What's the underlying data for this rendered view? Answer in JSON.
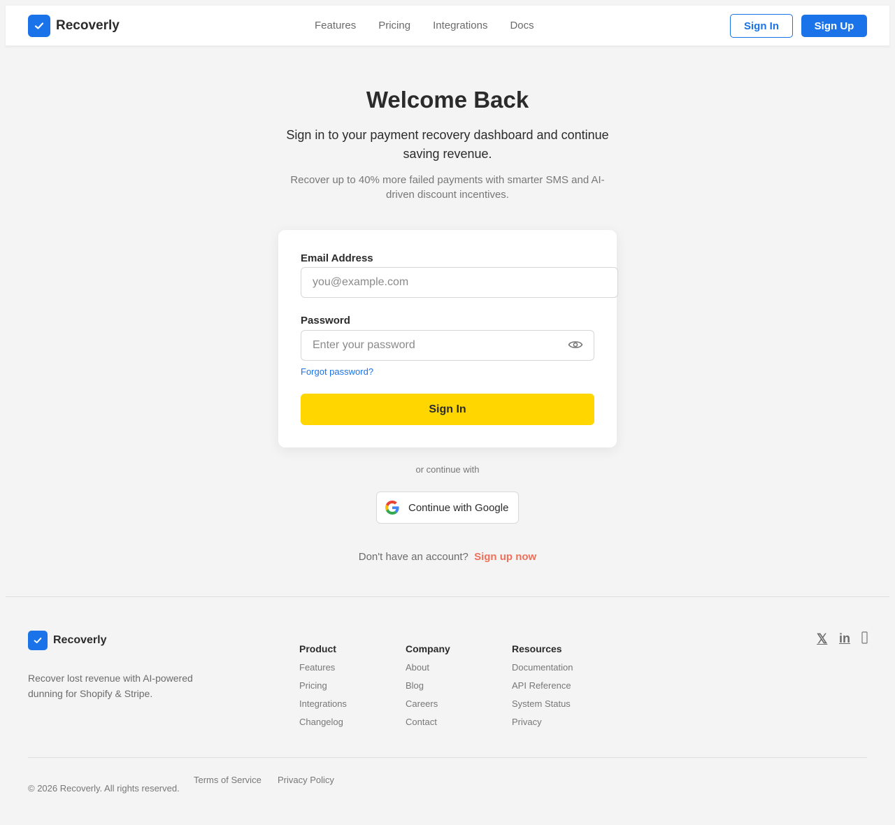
{
  "header": {
    "brand": "Recoverly",
    "nav": [
      "Features",
      "Pricing",
      "Integrations",
      "Docs"
    ],
    "sign_in": "Sign In",
    "sign_up": "Sign Up"
  },
  "hero": {
    "title": "Welcome Back",
    "subtitle": "Sign in to your payment recovery dashboard and continue saving revenue.",
    "note": "Recover up to 40% more failed payments with smarter SMS and AI-driven discount incentives."
  },
  "form": {
    "email_label": "Email Address",
    "email_placeholder": "you@example.com",
    "password_label": "Password",
    "password_placeholder": "Enter your password",
    "forgot": "Forgot password?",
    "submit": "Sign In",
    "eye_icon": "eye-icon"
  },
  "alt_auth": {
    "divider": "or continue with",
    "google": "Continue with Google"
  },
  "signup_prompt": {
    "text": "Don't have an account?",
    "link": "Sign up now"
  },
  "footer": {
    "brand": "Recoverly",
    "description": "Recover lost revenue with AI-powered dunning for Shopify & Stripe.",
    "columns": [
      {
        "title": "Product",
        "links": [
          "Features",
          "Pricing",
          "Integrations",
          "Changelog"
        ]
      },
      {
        "title": "Company",
        "links": [
          "About",
          "Blog",
          "Careers",
          "Contact"
        ]
      },
      {
        "title": "Resources",
        "links": [
          "Documentation",
          "API Reference",
          "System Status",
          "Privacy"
        ]
      }
    ],
    "social": [
      "x-icon",
      "linkedin-icon",
      "github-icon"
    ],
    "social_x": "𝕏",
    "social_linkedin": "in",
    "copyright": "© 2026 Recoverly. All rights reserved.",
    "terms": "Terms of Service",
    "privacy_policy": "Privacy Policy"
  },
  "colors": {
    "primary": "#1a73e8",
    "cta_yellow": "#ffd600",
    "signup_link": "#f0705a",
    "background": "#f4f4f4"
  }
}
